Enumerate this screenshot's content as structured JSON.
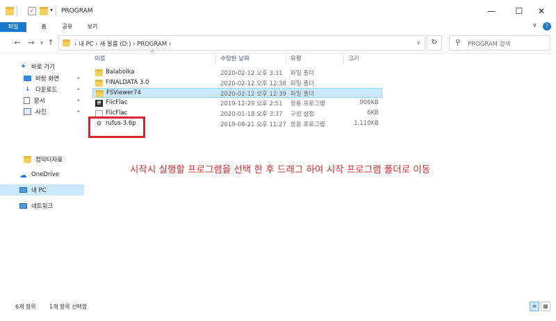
{
  "window": {
    "title": "PROGRAM",
    "controls": {
      "minimize": "—",
      "maximize": "☐",
      "close": "✕"
    }
  },
  "ribbon": {
    "tabs": [
      "파일",
      "홈",
      "공유",
      "보기"
    ],
    "collapse": "∨",
    "help": "?"
  },
  "nav": {
    "back": "←",
    "forward": "→",
    "recent": "∨",
    "up": "↑",
    "address": "›  내 PC  ›  새 볼륨 (D:)  ›  PROGRAM  ›",
    "address_dropdown": "∨",
    "refresh": "↻",
    "search_icon": "⚲",
    "search_placeholder": "PROGRAM 검색"
  },
  "sidebar": {
    "items": [
      {
        "label": "바로 가기",
        "icon": "star-icon",
        "pinned": false
      },
      {
        "label": "바탕 화면",
        "icon": "desktop-icon",
        "pinned": true
      },
      {
        "label": "다운로드",
        "icon": "download-icon",
        "pinned": true
      },
      {
        "label": "문서",
        "icon": "document-icon",
        "pinned": true
      },
      {
        "label": "사진",
        "icon": "pictures-icon",
        "pinned": true
      },
      {
        "label": "컴닥터자료",
        "icon": "folder-icon",
        "pinned": false
      },
      {
        "label": "OneDrive",
        "icon": "cloud-icon",
        "pinned": false
      },
      {
        "label": "내 PC",
        "icon": "pc-icon",
        "pinned": false
      },
      {
        "label": "네트워크",
        "icon": "network-icon",
        "pinned": false
      }
    ],
    "pin_glyph": "📌"
  },
  "columns": {
    "name": "이름",
    "date": "수정한 날짜",
    "type": "유형",
    "size": "크기",
    "sort_arrow": "^"
  },
  "files": [
    {
      "name": "Balabolka",
      "date": "2020-02-12 오후 3:31",
      "type": "파일 폴더",
      "size": "",
      "icon": "folder-icon"
    },
    {
      "name": "FINALDATA 3.0",
      "date": "2020-02-12 오후 12:38",
      "type": "파일 폴더",
      "size": "",
      "icon": "folder-icon"
    },
    {
      "name": "FSViewer74",
      "date": "2020-02-12 오후 12:39",
      "type": "파일 폴더",
      "size": "",
      "icon": "folder-icon"
    },
    {
      "name": "FlicFlac",
      "date": "2019-12-29 오후 2:51",
      "type": "응용 프로그램",
      "size": "906KB",
      "icon": "app-icon"
    },
    {
      "name": "FlicFlac",
      "date": "2020-01-18 오후 3:37",
      "type": "구성 설정",
      "size": "6KB",
      "icon": "config-icon"
    },
    {
      "name": "rufus-3.6p",
      "date": "2019-08-21 오후 11:27",
      "type": "응용 프로그램",
      "size": "1,110KB",
      "icon": "usb-icon"
    }
  ],
  "annotation": "시작시 실행할 프로그램을  선택 한 후 드래그 하여 시작 프로그램 폴더로 이동",
  "status": {
    "item_count": "6개 항목",
    "selected": "1개 항목 선택함"
  },
  "colors": {
    "accent": "#1979ca",
    "selection": "#cce8ff",
    "annotation": "#d12e2e"
  }
}
